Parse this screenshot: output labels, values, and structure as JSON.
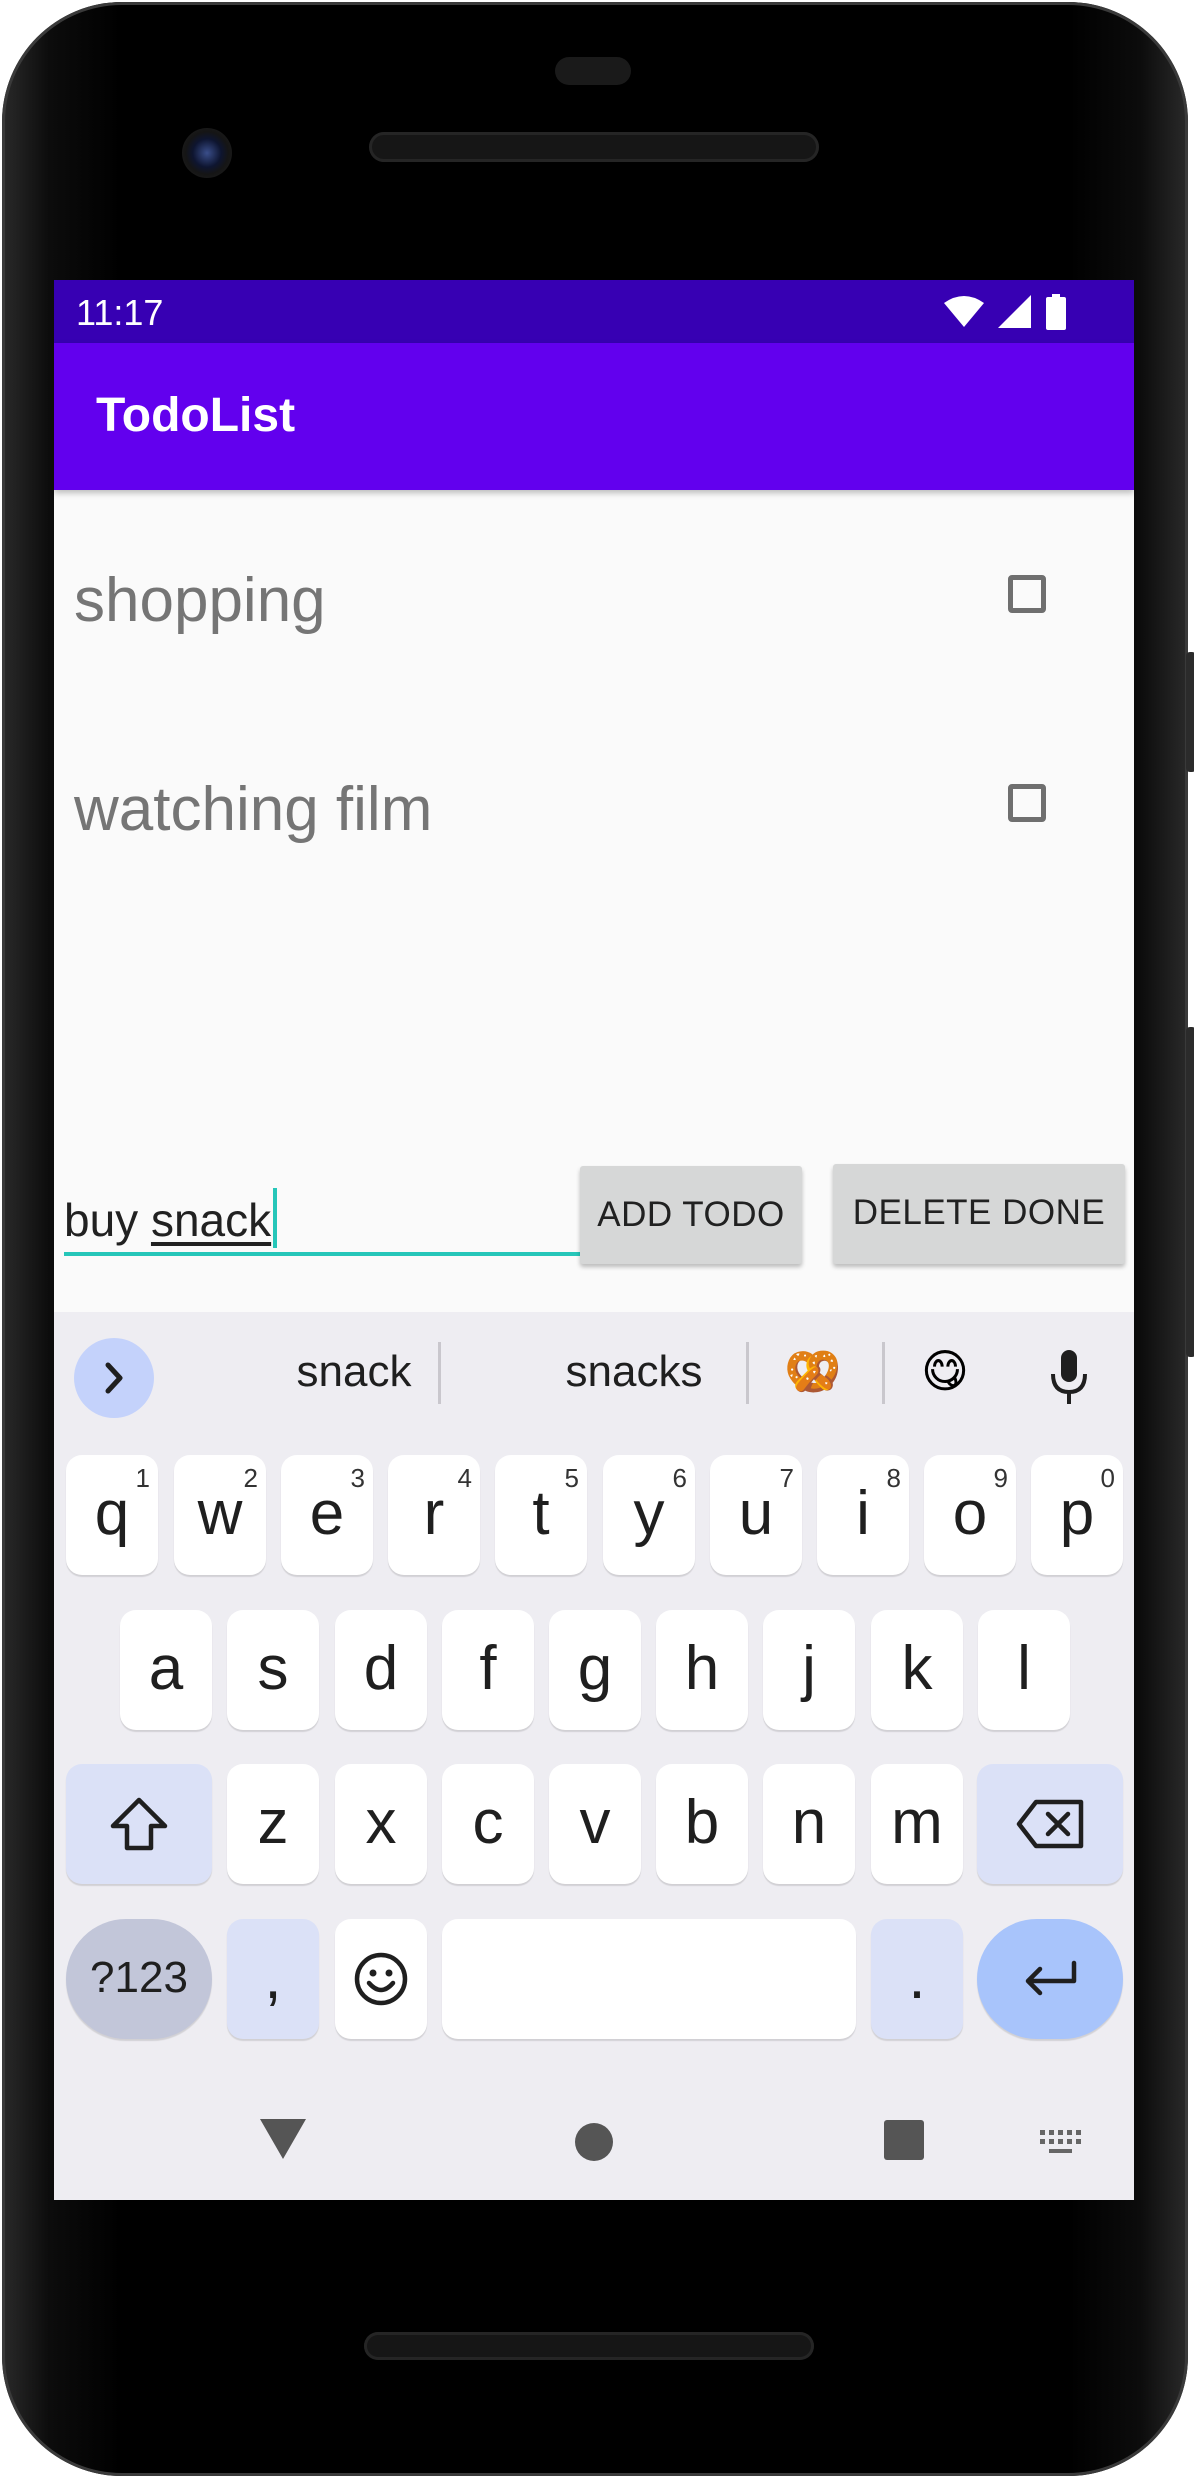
{
  "status_bar": {
    "time": "11:17"
  },
  "app_bar": {
    "title": "TodoList"
  },
  "todos": [
    {
      "text": "shopping",
      "done": false
    },
    {
      "text": "watching film",
      "done": false
    }
  ],
  "input": {
    "value_prefix": "buy ",
    "value_composing": "snack"
  },
  "buttons": {
    "add": "ADD TODO",
    "delete": "DELETE DONE"
  },
  "keyboard": {
    "suggestions": [
      "snack",
      "snacks"
    ],
    "emoji_suggestions": [
      "🥨",
      "😋"
    ],
    "row1": [
      {
        "key": "q",
        "hint": "1"
      },
      {
        "key": "w",
        "hint": "2"
      },
      {
        "key": "e",
        "hint": "3"
      },
      {
        "key": "r",
        "hint": "4"
      },
      {
        "key": "t",
        "hint": "5"
      },
      {
        "key": "y",
        "hint": "6"
      },
      {
        "key": "u",
        "hint": "7"
      },
      {
        "key": "i",
        "hint": "8"
      },
      {
        "key": "o",
        "hint": "9"
      },
      {
        "key": "p",
        "hint": "0"
      }
    ],
    "row2": [
      "a",
      "s",
      "d",
      "f",
      "g",
      "h",
      "j",
      "k",
      "l"
    ],
    "row3": [
      "z",
      "x",
      "c",
      "v",
      "b",
      "n",
      "m"
    ],
    "symbols_label": "?123",
    "comma_label": ",",
    "period_label": "."
  },
  "colors": {
    "status_bar": "#3700b3",
    "app_bar": "#6200ee",
    "accent": "#26c6b9",
    "button": "#d6d7d7"
  },
  "icons": [
    "wifi-icon",
    "signal-icon",
    "battery-icon",
    "chevron-right-icon",
    "mic-icon",
    "shift-icon",
    "backspace-icon",
    "emoji-icon",
    "enter-icon",
    "back-icon",
    "home-icon",
    "recents-icon",
    "keyboard-icon"
  ]
}
